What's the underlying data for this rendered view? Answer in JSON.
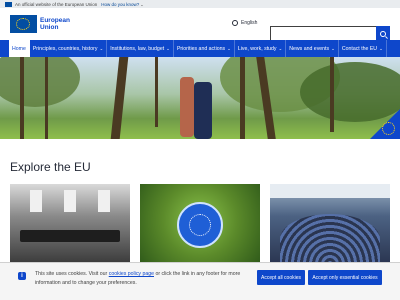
{
  "official_bar": {
    "text": "An official website of the European Union",
    "how_link": "How do you know?"
  },
  "header": {
    "logo_line1": "European",
    "logo_line2": "Union",
    "language": "English",
    "search_placeholder": ""
  },
  "nav": {
    "items": [
      {
        "label": "Home"
      },
      {
        "label": "Principles, countries, history"
      },
      {
        "label": "Institutions, law, budget"
      },
      {
        "label": "Priorities and actions"
      },
      {
        "label": "Live, work, study"
      },
      {
        "label": "News and events"
      },
      {
        "label": "Contact the EU"
      }
    ]
  },
  "main": {
    "explore_title": "Explore the EU"
  },
  "cookie": {
    "text_before": "This site uses cookies. Visit our ",
    "policy_link": "cookies policy page",
    "text_after": " or click the link in any footer for more information and to change your preferences.",
    "accept_all": "Accept all cookies",
    "accept_essential": "Accept only essential cookies"
  },
  "colors": {
    "brand_blue": "#0e47cb",
    "flag_blue": "#034ea2",
    "flag_yellow": "#ffd617"
  }
}
